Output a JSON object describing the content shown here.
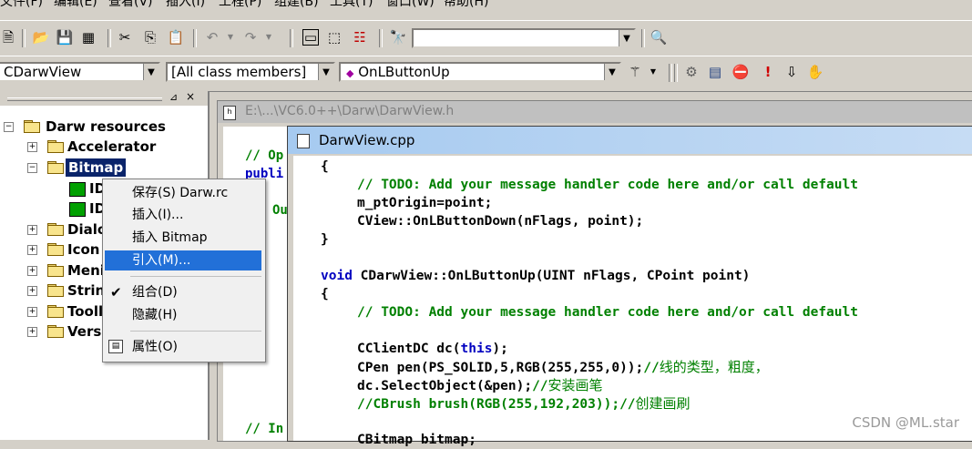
{
  "menubar": {
    "items": [
      "文件(F)",
      "编辑(E)",
      "查看(V)",
      "插入(I)",
      "工程(P)",
      "组建(B)",
      "工具(T)",
      "窗口(W)",
      "帮助(H)"
    ]
  },
  "toolbar1": {
    "find_combo_value": ""
  },
  "toolbar2": {
    "class_combo": "CDarwView",
    "filter_combo": "[All class members]",
    "member_combo": "OnLButtonUp"
  },
  "tree": {
    "root": "Darw resources",
    "items": [
      {
        "label": "Accelerator",
        "expanded": false
      },
      {
        "label": "Bitmap",
        "expanded": true,
        "selected": true
      },
      {
        "label": "ID",
        "child": true
      },
      {
        "label": "ID",
        "child": true
      },
      {
        "label": "Dialo",
        "expanded": false
      },
      {
        "label": "Icon",
        "expanded": false
      },
      {
        "label": "Meni",
        "expanded": false
      },
      {
        "label": "Strin",
        "expanded": false
      },
      {
        "label": "Tooll",
        "expanded": false
      },
      {
        "label": "Vers",
        "expanded": false
      }
    ]
  },
  "back_window": {
    "title": "E:\\...\\VC6.0++\\Darw\\DarwView.h",
    "lines": [
      "// Op",
      "publi",
      "Ou",
      "// In"
    ]
  },
  "front_window": {
    "title": "DarwView.cpp"
  },
  "context_menu": {
    "items": [
      "保存(S) Darw.rc",
      "插入(I)...",
      "插入 Bitmap",
      "引入(M)...",
      "组合(D)",
      "隐藏(H)",
      "属性(O)"
    ],
    "highlighted": "引入(M)...",
    "checked": "组合(D)"
  },
  "watermark": "CSDN @ML.star",
  "colors": {
    "keyword": "#0000c0",
    "comment": "#008000",
    "highlight": "#2270d8",
    "window_bg": "#d4d0c8"
  }
}
